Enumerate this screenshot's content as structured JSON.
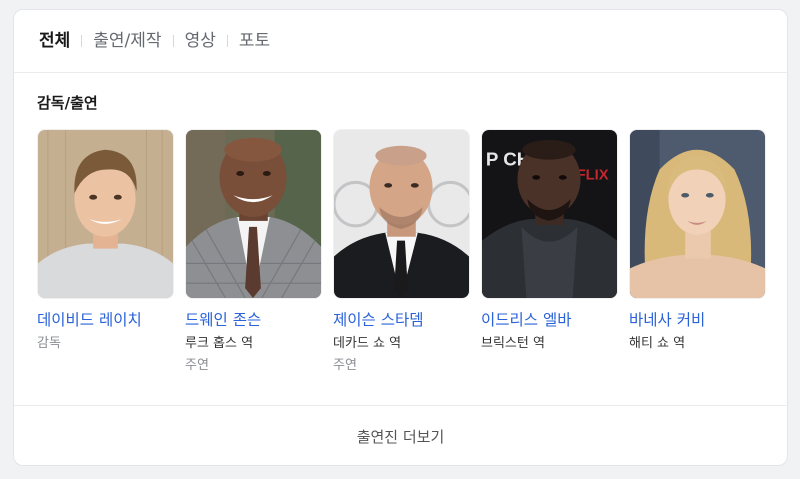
{
  "tabs": [
    {
      "label": "전체",
      "active": true
    },
    {
      "label": "출연/제작",
      "active": false
    },
    {
      "label": "영상",
      "active": false
    },
    {
      "label": "포토",
      "active": false
    }
  ],
  "section_title": "감독/출연",
  "cast": [
    {
      "name": "데이비드 레이치",
      "role": "감독",
      "type": ""
    },
    {
      "name": "드웨인 존슨",
      "role": "루크 홉스 역",
      "type": "주연"
    },
    {
      "name": "제이슨 스타뎀",
      "role": "데카드 쇼 역",
      "type": "주연"
    },
    {
      "name": "이드리스 엘바",
      "role": "브릭스턴 역",
      "type": ""
    },
    {
      "name": "바네사 커비",
      "role": "해티 쇼 역",
      "type": ""
    }
  ],
  "more_label": "출연진 더보기",
  "colors": {
    "link": "#2a62d8",
    "muted": "#8a8d92",
    "background": "#f1f2f4"
  }
}
